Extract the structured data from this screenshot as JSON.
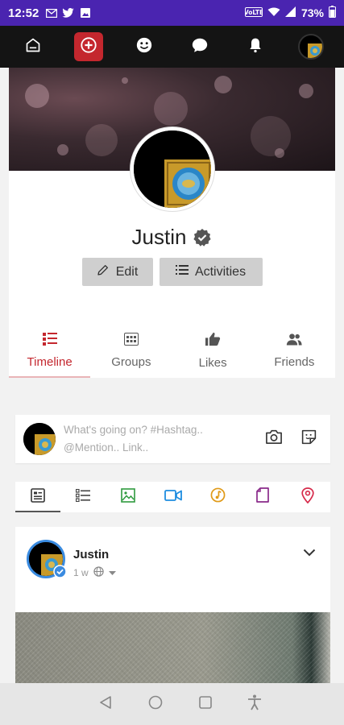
{
  "status_bar": {
    "time": "12:52",
    "battery": "73%",
    "icons": [
      "gmail-icon",
      "twitter-icon",
      "gallery-icon",
      "volte-icon",
      "wifi-icon",
      "signal-icon",
      "battery-icon"
    ]
  },
  "top_nav": {
    "items": [
      "home-icon",
      "create-icon",
      "emoji-icon",
      "chat-icon",
      "bell-icon",
      "avatar"
    ],
    "active_index": 1,
    "accent": "#c4272e"
  },
  "profile": {
    "name": "Justin",
    "verified": true,
    "edit_label": "Edit",
    "activities_label": "Activities"
  },
  "tabs": [
    {
      "label": "Timeline",
      "icon": "timeline-icon",
      "active": true
    },
    {
      "label": "Groups",
      "icon": "groups-icon",
      "active": false
    },
    {
      "label": "Likes",
      "icon": "likes-icon",
      "active": false
    },
    {
      "label": "Friends",
      "icon": "friends-icon",
      "active": false
    }
  ],
  "composer": {
    "placeholder_line1": "What's going on? #Hashtag..",
    "placeholder_line2": "@Mention.. Link.."
  },
  "post_types": [
    "text-post-icon",
    "list-post-icon",
    "image-post-icon",
    "video-post-icon",
    "music-post-icon",
    "file-post-icon",
    "location-post-icon"
  ],
  "post": {
    "author": "Justin",
    "time": "1 w",
    "privacy": "globe-icon"
  },
  "colors": {
    "status_bar": "#4a24b0",
    "nav_bg": "#141414",
    "accent": "#c4272e"
  }
}
